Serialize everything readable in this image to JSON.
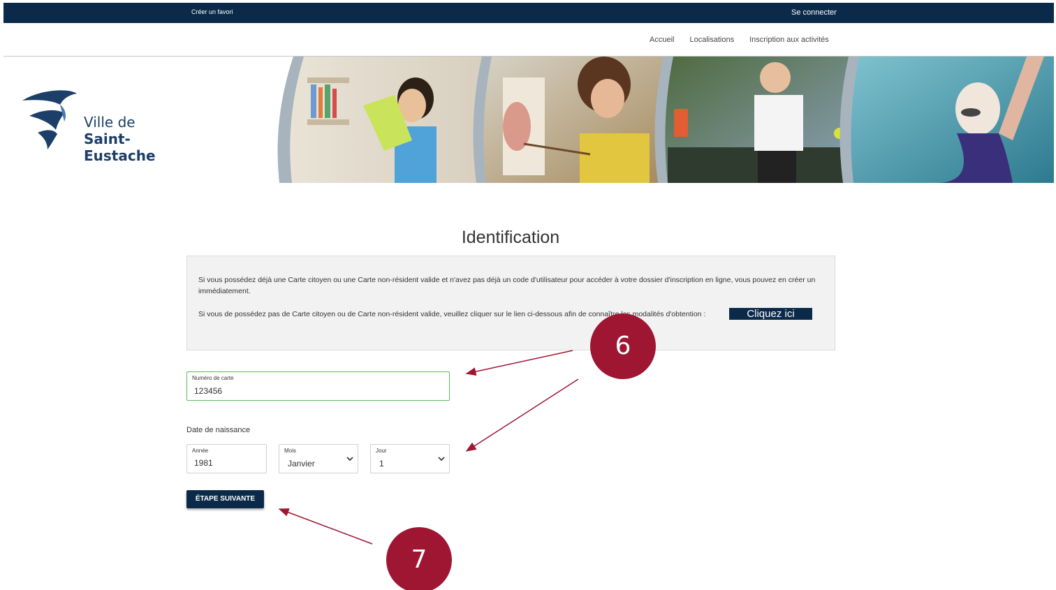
{
  "topbar": {
    "favorite_link": "Créer un favori",
    "login_link": "Se connecter"
  },
  "nav": {
    "items": [
      "Accueil",
      "Localisations",
      "Inscription aux activités"
    ]
  },
  "logo": {
    "line1": "Ville de",
    "line2": "Saint-Eustache"
  },
  "page": {
    "title": "Identification"
  },
  "info": {
    "paragraph1": "Si vous possédez déjà une Carte citoyen ou une Carte non-résident valide et n'avez pas déjà un code d'utilisateur pour accéder à votre dossier d'inscription en ligne, vous pouvez en créer un immédiatement.",
    "paragraph2": "Si vous de possédez pas de Carte citoyen ou de Carte non-résident valide, veuillez cliquer sur le lien ci-dessous afin de connaître les modalités d'obtention :",
    "cta_label": "Cliquez ici"
  },
  "form": {
    "card_label": "Numéro de carte",
    "card_value": "123456",
    "dob_label": "Date de naissance",
    "year_label": "Année",
    "year_value": "1981",
    "month_label": "Mois",
    "month_value": "Janvier",
    "day_label": "Jour",
    "day_value": "1",
    "next_button": "ÉTAPE SUIVANTE"
  },
  "annotations": {
    "badge6": "6",
    "badge7": "7",
    "color": "#9e1631"
  },
  "colors": {
    "brand_navy": "#0b2a4a",
    "field_valid_border": "#5cb85c"
  }
}
